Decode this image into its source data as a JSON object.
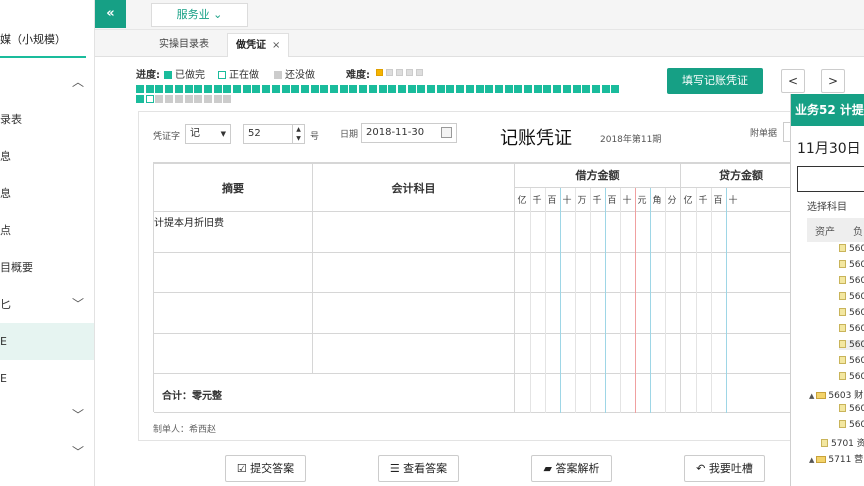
{
  "sidebar": {
    "company": "媒（小规模）",
    "items": [
      {
        "label": "",
        "chevron": "up"
      },
      {
        "label": "录表",
        "chevron": ""
      },
      {
        "label": "息",
        "chevron": ""
      },
      {
        "label": "息",
        "chevron": ""
      },
      {
        "label": "点",
        "chevron": ""
      },
      {
        "label": "目概要",
        "chevron": ""
      },
      {
        "label": "匕",
        "chevron": "down"
      },
      {
        "label": "E",
        "chevron": "",
        "active": true
      },
      {
        "label": "E",
        "chevron": ""
      },
      {
        "label": "",
        "chevron": "down"
      },
      {
        "label": "",
        "chevron": "down"
      }
    ]
  },
  "topbar": {
    "collapse": "«",
    "industry": "服务业"
  },
  "tabs": [
    {
      "label": "实操目录表",
      "active": false,
      "closable": false
    },
    {
      "label": "做凭证",
      "active": true,
      "closable": true
    }
  ],
  "progress": {
    "label": "进度:",
    "legend": {
      "done": "已做完",
      "doing": "正在做",
      "todo": "还没做"
    },
    "difficulty_label": "难度:",
    "difficulty": 1,
    "difficulty_max": 5,
    "row1": "dddddddddddddddddddddddddddddddddddddddddddddddddddddddddddddddddddddddddd",
    "row2": "dwtttttttt"
  },
  "actions": {
    "fill_voucher": "填写记账凭证",
    "prev": "<",
    "next": ">"
  },
  "voucher": {
    "type_label": "凭证字",
    "type_value": "记",
    "number": "52",
    "number_suffix": "号",
    "date_label": "日期",
    "date_value": "2018-11-30",
    "title": "记账凭证",
    "period": "2018年第11期",
    "attachments_label": "附单据",
    "columns": {
      "summary": "摘要",
      "account": "会计科目",
      "debit": "借方金额",
      "credit": "贷方金额"
    },
    "digits": [
      "亿",
      "千",
      "百",
      "十",
      "万",
      "千",
      "百",
      "十",
      "元",
      "角",
      "分"
    ],
    "credit_digits_visible": [
      "亿",
      "千",
      "百",
      "十"
    ],
    "rows": [
      {
        "summary": "计提本月折旧费",
        "account": ""
      },
      {
        "summary": "",
        "account": ""
      },
      {
        "summary": "",
        "account": ""
      },
      {
        "summary": "",
        "account": ""
      }
    ],
    "total": "合计：零元整",
    "maker": "制单人：希西赵"
  },
  "buttons": {
    "submit": "提交答案",
    "view": "查看答案",
    "analysis": "答案解析",
    "feedback": "我要吐槽"
  },
  "popup": {
    "title": "业务52 计提",
    "date": "11月30日",
    "select_label": "选择科目",
    "tabs": [
      "资产",
      "负"
    ],
    "nodes": [
      {
        "text": "560",
        "level": 2,
        "type": "file",
        "highlight": false
      },
      {
        "text": "560",
        "level": 2,
        "type": "file",
        "highlight": false
      },
      {
        "text": "560",
        "level": 2,
        "type": "file",
        "highlight": false
      },
      {
        "text": "560",
        "level": 2,
        "type": "file",
        "highlight": false
      },
      {
        "text": "560",
        "level": 2,
        "type": "file",
        "highlight": false
      },
      {
        "text": "560",
        "level": 2,
        "type": "file",
        "highlight": false
      },
      {
        "text": "560",
        "level": 2,
        "type": "file",
        "highlight": true
      },
      {
        "text": "560",
        "level": 2,
        "type": "file",
        "highlight": false
      },
      {
        "text": "560",
        "level": 2,
        "type": "file",
        "highlight": false
      },
      {
        "text": "5603 财",
        "level": 1,
        "type": "folder",
        "highlight": false
      },
      {
        "text": "560",
        "level": 2,
        "type": "file",
        "highlight": false
      },
      {
        "text": "560",
        "level": 2,
        "type": "file",
        "highlight": false
      },
      {
        "text": "5701 资",
        "level": 1,
        "type": "file",
        "highlight": false
      },
      {
        "text": "5711 营",
        "level": 1,
        "type": "folder",
        "highlight": false
      }
    ]
  },
  "colors": {
    "brand": "#16a085",
    "done": "#1abc9c",
    "todo": "#cccccc",
    "doing_border": "#1abc9c"
  }
}
